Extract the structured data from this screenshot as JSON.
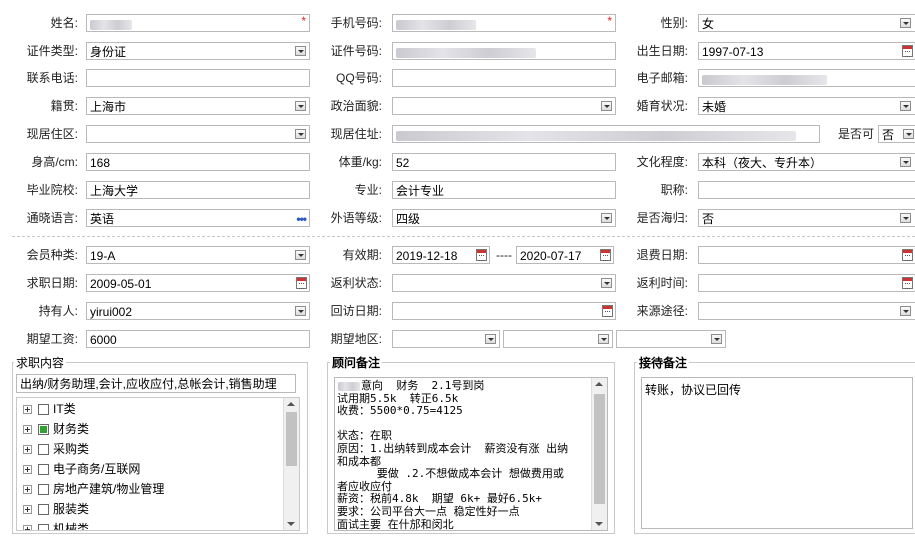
{
  "labels": {
    "name": "姓名:",
    "mobile": "手机号码:",
    "gender": "性别:",
    "id_type": "证件类型:",
    "id_number": "证件号码:",
    "birth_date": "出生日期:",
    "phone": "联系电话:",
    "qq": "QQ号码:",
    "email": "电子邮箱:",
    "native_place": "籍贯:",
    "political": "政治面貌:",
    "marital": "婚育状况:",
    "residence_area": "现居住区:",
    "residence_address": "现居住址:",
    "is_available": "是否可",
    "height": "身高/cm:",
    "weight": "体重/kg:",
    "education": "文化程度:",
    "school": "毕业院校:",
    "major": "专业:",
    "title": "职称:",
    "languages": "通晓语言:",
    "foreign_level": "外语等级:",
    "returnee": "是否海归:",
    "member_type": "会员种类:",
    "valid_period": "有效期:",
    "refund_date": "退费日期:",
    "job_date": "求职日期:",
    "rebate_status": "返利状态:",
    "rebate_time": "返利时间:",
    "holder": "持有人:",
    "visit_date": "回访日期:",
    "source": "来源途径:",
    "salary": "期望工资:",
    "region": "期望地区:",
    "job_content": "求职内容",
    "consultant_notes": "顾问备注",
    "reception_notes": "接待备注"
  },
  "values": {
    "gender": "女",
    "id_type": "身份证",
    "birth_date": "1997-07-13",
    "native_place": "上海市",
    "marital": "未婚",
    "is_available": "否",
    "height": "168",
    "weight": "52",
    "education": "本科（夜大、专升本）",
    "school": "上海大学",
    "major": "会计专业",
    "languages": "英语",
    "foreign_level": "四级",
    "returnee": "否",
    "member_type": "19-A",
    "valid_from": "2019-12-18",
    "valid_sep": "----",
    "valid_to": "2020-07-17",
    "job_date": "2009-05-01",
    "holder": "yirui002",
    "salary": "6000",
    "job_content": "出纳/财务助理,会计,应收应付,总帐会计,销售助理",
    "reception_notes": "转账，协议已回传"
  },
  "consultant_lines": [
    "意向  财务  2.1号到岗",
    "试用期5.5k  转正6.5k",
    "收费：5500*0.75=4125",
    "",
    "状态：在职",
    "原因：1.出纳转到成本会计  薪资没有涨 出纳",
    "和成本都",
    "      要做 .2.不想做成本会计 想做费用或",
    "者应收应付",
    "薪资：税前4.8k  期望 6k+ 最好6.5k+",
    "要求：公司平台大一点 稳定性好一点",
    "面试主要 在什邡和闵北"
  ],
  "job_tree": [
    {
      "label": "IT类",
      "checked": false
    },
    {
      "label": "财务类",
      "checked": true
    },
    {
      "label": "采购类",
      "checked": false
    },
    {
      "label": "电子商务/互联网",
      "checked": false
    },
    {
      "label": "房地产建筑/物业管理",
      "checked": false
    },
    {
      "label": "服装类",
      "checked": false
    },
    {
      "label": "机械类",
      "checked": false
    }
  ],
  "colors": {
    "required": "#e02020",
    "checked": "#2fa32f",
    "border": "#b9b9b9",
    "dots": "#2a56c6"
  }
}
